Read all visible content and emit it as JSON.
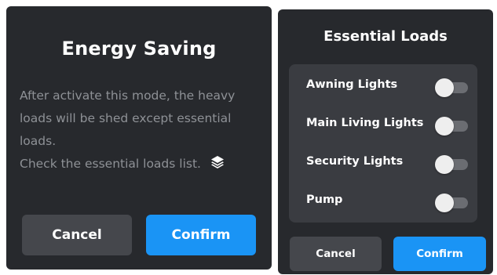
{
  "energy_dialog": {
    "title": "Energy Saving",
    "body_lines": [
      "After activate this mode, the heavy",
      "loads will be shed except essential",
      "loads."
    ],
    "check_text": "Check the essential loads list.",
    "check_icon": "layers-icon",
    "cancel_label": "Cancel",
    "confirm_label": "Confirm"
  },
  "essential_dialog": {
    "title": "Essential Loads",
    "loads": [
      {
        "label": "Awning Lights",
        "enabled": false
      },
      {
        "label": "Main Living Lights",
        "enabled": false
      },
      {
        "label": "Security Lights",
        "enabled": false
      },
      {
        "label": "Pump",
        "enabled": false
      }
    ],
    "cancel_label": "Cancel",
    "confirm_label": "Confirm"
  },
  "colors": {
    "dialog_bg": "#27292d",
    "panel_bg": "#3a3c41",
    "cancel_bg": "#45474c",
    "confirm_bg": "#1a94f5",
    "body_text": "#8e9196"
  }
}
